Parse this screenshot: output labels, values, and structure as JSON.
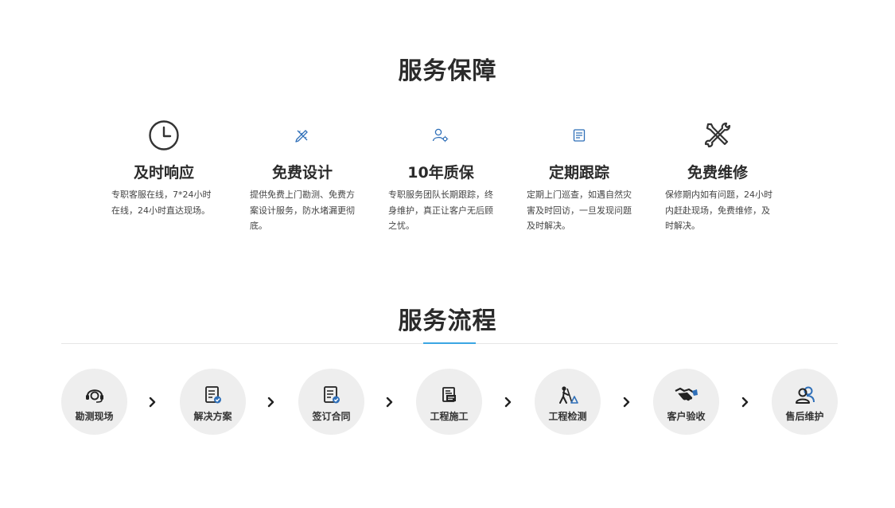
{
  "guarantee": {
    "title": "服务保障",
    "items": [
      {
        "title": "及时响应",
        "desc": "专职客服在线，7*24小时在线，24小时直达现场。",
        "icon": "clock-icon"
      },
      {
        "title": "免费设计",
        "desc": "提供免费上门勘测、免费方案设计服务，防水堵漏更彻底。",
        "icon": "ruler-pencil-icon"
      },
      {
        "title": "10年质保",
        "desc": "专职服务团队长期跟踪，终身维护，真正让客户无后顾之忧。",
        "icon": "user-gear-icon"
      },
      {
        "title": "定期跟踪",
        "desc": "定期上门巡查，如遇自然灾害及时回访，一旦发现问题及时解决。",
        "icon": "document-icon"
      },
      {
        "title": "免费维修",
        "desc": "保修期内如有问题，24小时内赶赴现场，免费维修，及时解决。",
        "icon": "tools-icon"
      }
    ]
  },
  "process": {
    "title": "服务流程",
    "steps": [
      {
        "label": "勘测现场",
        "icon": "headset-icon"
      },
      {
        "label": "解决方案",
        "icon": "checklist-icon"
      },
      {
        "label": "签订合同",
        "icon": "contract-icon"
      },
      {
        "label": "工程施工",
        "icon": "construction-icon"
      },
      {
        "label": "工程检测",
        "icon": "worker-icon"
      },
      {
        "label": "客户验收",
        "icon": "handshake-icon"
      },
      {
        "label": "售后维护",
        "icon": "users-icon"
      }
    ]
  },
  "colors": {
    "accent": "#3ba6e3",
    "icon_blue": "#2f6fb8",
    "step_bg": "#eeeeee"
  }
}
